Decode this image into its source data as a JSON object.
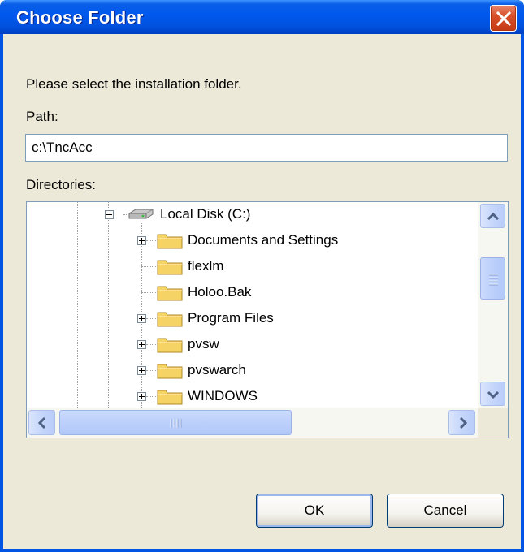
{
  "window": {
    "title": "Choose Folder",
    "close_icon": "close-icon"
  },
  "prompt": "Please select the installation folder.",
  "path": {
    "label": "Path:",
    "value": "c:\\TncAcc"
  },
  "directories": {
    "label": "Directories:",
    "root": {
      "label": "Local Disk (C:)",
      "icon": "drive-icon",
      "expanded": true
    },
    "items": [
      {
        "label": "Documents and Settings",
        "icon": "folder-icon",
        "expandable": true
      },
      {
        "label": "flexlm",
        "icon": "folder-icon",
        "expandable": false
      },
      {
        "label": "Holoo.Bak",
        "icon": "folder-icon",
        "expandable": false
      },
      {
        "label": "Program Files",
        "icon": "folder-icon",
        "expandable": true
      },
      {
        "label": "pvsw",
        "icon": "folder-icon",
        "expandable": true
      },
      {
        "label": "pvswarch",
        "icon": "folder-icon",
        "expandable": true
      },
      {
        "label": "WINDOWS",
        "icon": "folder-icon",
        "expandable": true
      }
    ]
  },
  "buttons": {
    "ok": "OK",
    "cancel": "Cancel"
  },
  "colors": {
    "title_bar": "#0054e3",
    "dialog_bg": "#ece9d8",
    "folder_fill": "#f6d365",
    "close_button": "#d8502a"
  }
}
